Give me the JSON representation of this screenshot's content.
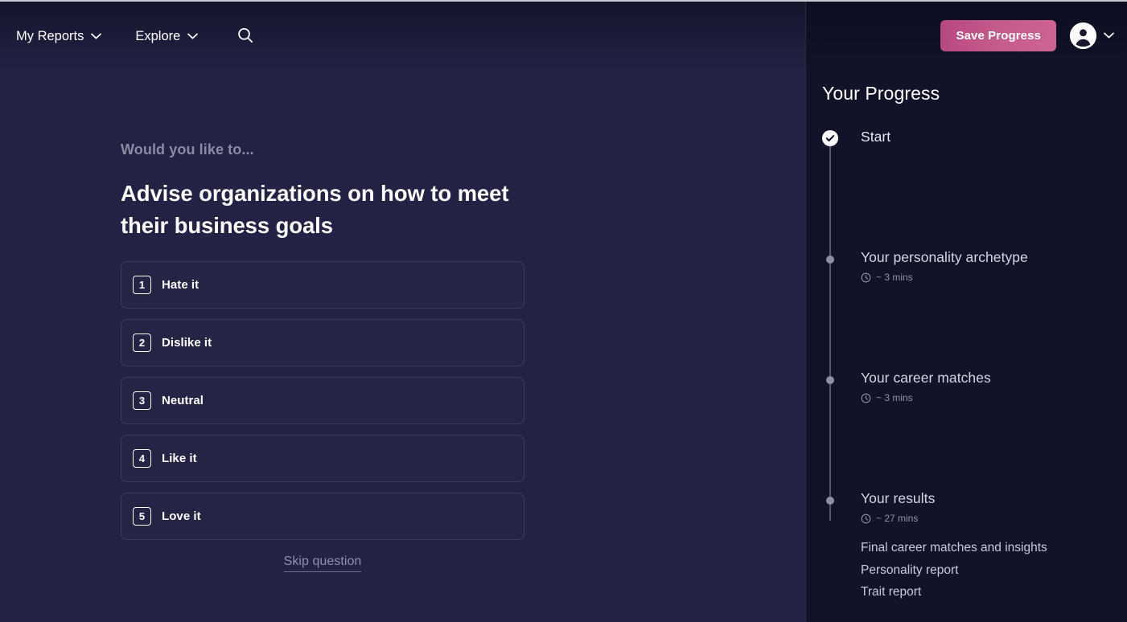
{
  "header": {
    "nav_items": [
      {
        "label": "My Reports",
        "icon": "chevron-down-icon"
      },
      {
        "label": "Explore",
        "icon": "chevron-down-icon"
      }
    ],
    "search_icon": "search-icon",
    "save_button": "Save Progress",
    "avatar_icon": "user-avatar-icon",
    "account_chevron": "chevron-down-icon"
  },
  "question": {
    "eyebrow": "Would you like to...",
    "title": "Advise organizations on how to meet their business goals",
    "options": [
      {
        "number": "1",
        "label": "Hate it"
      },
      {
        "number": "2",
        "label": "Dislike it"
      },
      {
        "number": "3",
        "label": "Neutral"
      },
      {
        "number": "4",
        "label": "Like it"
      },
      {
        "number": "5",
        "label": "Love it"
      }
    ],
    "skip_label": "Skip question"
  },
  "progress": {
    "title": "Your Progress",
    "steps": [
      {
        "label": "Start",
        "state": "done",
        "duration": "",
        "marker_icon": "check-circle-icon",
        "sub_items": []
      },
      {
        "label": "Your personality archetype",
        "state": "todo",
        "duration": "~ 3 mins",
        "clock_icon": "clock-icon",
        "marker_icon": "dot-icon",
        "sub_items": []
      },
      {
        "label": "Your career matches",
        "state": "todo",
        "duration": "~ 3 mins",
        "clock_icon": "clock-icon",
        "marker_icon": "dot-icon",
        "sub_items": []
      },
      {
        "label": "Your results",
        "state": "todo",
        "duration": "~ 27 mins",
        "clock_icon": "clock-icon",
        "marker_icon": "dot-icon",
        "sub_items": [
          "Final career matches and insights",
          "Personality report",
          "Trait report"
        ]
      }
    ]
  },
  "colors": {
    "main_background": "#232244",
    "sidebar_background": "#121228",
    "accent_pink": "#c55a8c",
    "option_background": "#252445",
    "option_border": "#3a3960",
    "muted_text": "#8b8aa3"
  }
}
